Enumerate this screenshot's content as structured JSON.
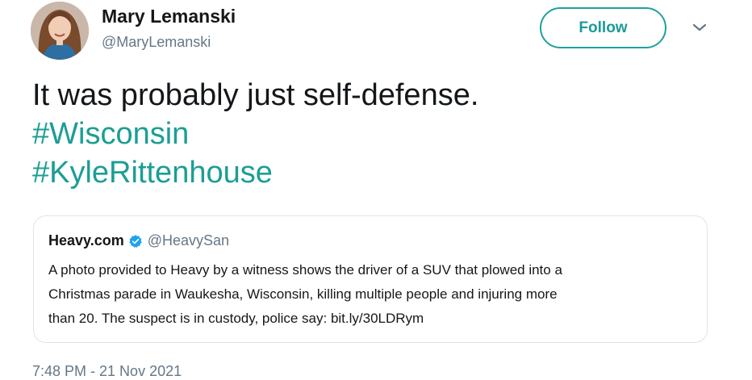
{
  "author": {
    "display_name": "Mary Lemanski",
    "handle": "@MaryLemanski",
    "avatar_icon": "profile-photo"
  },
  "follow_button": {
    "label": "Follow"
  },
  "menu_icon": "chevron-down-icon",
  "tweet": {
    "lines": [
      {
        "text": "It was probably just self-defense.",
        "type": "text"
      },
      {
        "text": "#Wisconsin",
        "type": "hashtag"
      },
      {
        "text": "#KyleRittenhouse",
        "type": "hashtag"
      }
    ]
  },
  "quoted_tweet": {
    "name": "Heavy.com",
    "verified": true,
    "handle": "@HeavySan",
    "body_lines": [
      "A photo provided to Heavy by a witness shows the driver of a SUV that plowed into a",
      "Christmas parade in Waukesha, Wisconsin, killing multiple people and injuring more",
      "than 20. The suspect is in custody, police say: bit.ly/30LDRym"
    ]
  },
  "timestamp": "7:48 PM - 21 Nov 2021",
  "colors": {
    "accent": "#1b9e94",
    "text": "#14171a",
    "secondary": "#657786",
    "verified": "#1da1f2",
    "border": "#dfe4e8"
  }
}
